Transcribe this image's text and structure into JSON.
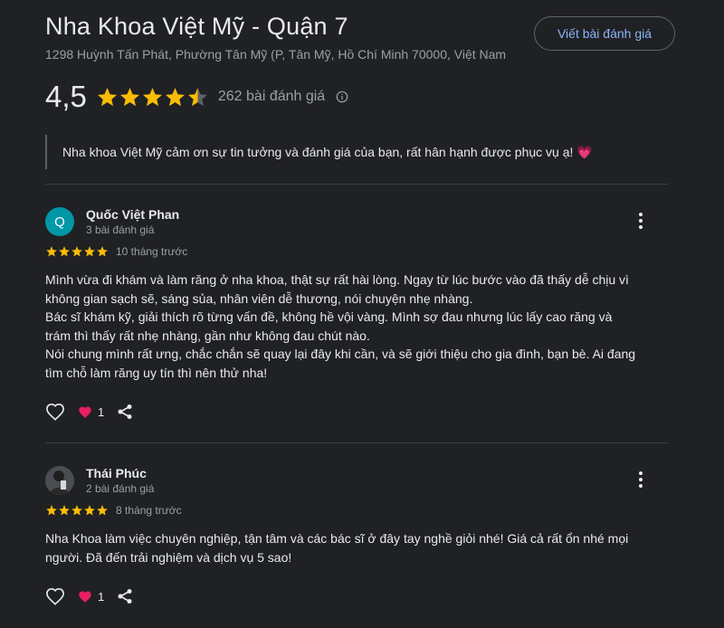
{
  "place": {
    "title": "Nha Khoa Việt Mỹ - Quận 7",
    "address": "1298 Huỳnh Tấn Phát, Phường Tân Mỹ (P, Tân Mỹ, Hồ Chí Minh 70000, Việt Nam",
    "write_review_label": "Viết bài đánh giá"
  },
  "summary": {
    "rating": "4,5",
    "stars": 4.5,
    "review_count": "262 bài đánh giá",
    "star_color": "#fbbc04"
  },
  "owner_reply": {
    "text": "Nha khoa Việt Mỹ cảm ơn sự tin tưởng và đánh giá của bạn, rất hân hạnh được phục vụ ạ! ",
    "emoji": "💗"
  },
  "reviews": [
    {
      "author": "Quốc Việt Phan",
      "avatar_letter": "Q",
      "avatar_color": "#0097a7",
      "review_count": "3 bài đánh giá",
      "stars": 5,
      "time": "10 tháng trước",
      "lines": [
        "Mình vừa đi khám và làm răng ở nha khoa, thật sự rất hài lòng. Ngay từ lúc bước vào đã thấy dễ chịu vì",
        "không gian sạch sẽ, sáng sủa, nhân viên dễ thương, nói chuyện nhẹ nhàng.",
        "Bác sĩ khám kỹ, giải thích rõ từng vấn đề, không hề vội vàng. Mình sợ đau nhưng lúc lấy cao răng và",
        "trám thì thấy rất nhẹ nhàng, gần như không đau chút nào.",
        "Nói chung mình rất ưng, chắc chắn sẽ quay lại đây khi cần, và sẽ giới thiệu cho gia đình, bạn bè. Ai đang",
        "tìm chỗ làm răng uy tín thì nên thử nha!"
      ],
      "reaction_count": "1"
    },
    {
      "author": "Thái Phúc",
      "avatar_letter": "",
      "avatar_color": "#5f6368",
      "review_count": "2 bài đánh giá",
      "stars": 5,
      "time": "8 tháng trước",
      "lines": [
        "Nha Khoa làm việc chuyên nghiệp, tận tâm và các bác sĩ ở đây tay nghề giỏi nhé! Giá cả rất ổn nhé mọi",
        "người. Đã đến trải nghiệm và dịch vụ 5 sao!"
      ],
      "reaction_count": "1"
    }
  ],
  "icons": {
    "info": "info-icon",
    "more": "more-vert-icon",
    "like": "heart-outline-icon",
    "love": "heart-reaction-icon",
    "share": "share-icon"
  }
}
